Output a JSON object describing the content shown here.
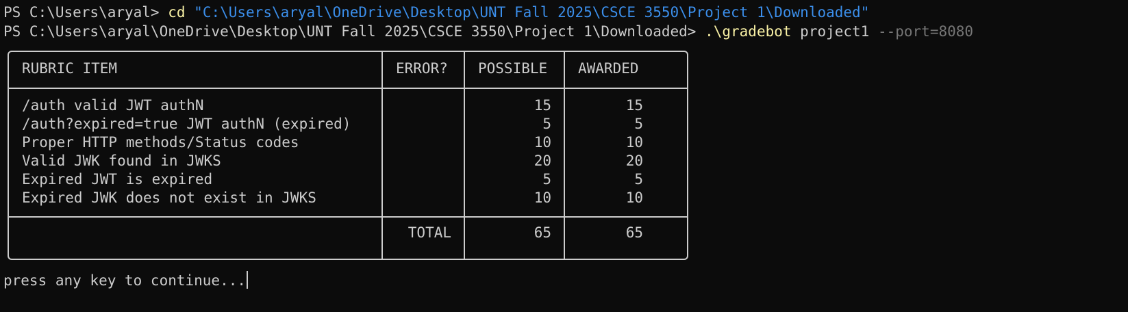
{
  "terminal": {
    "line1": {
      "prompt": "PS C:\\Users\\aryal> ",
      "command": "cd",
      "argument": "\"C:\\Users\\aryal\\OneDrive\\Desktop\\UNT Fall 2025\\CSCE 3550\\Project 1\\Downloaded\""
    },
    "line2": {
      "prompt": "PS C:\\Users\\aryal\\OneDrive\\Desktop\\UNT Fall 2025\\CSCE 3550\\Project 1\\Downloaded> ",
      "command": ".\\gradebot",
      "argument": " project1 ",
      "flag": "--port=8080"
    },
    "press_key": "press any key to continue..."
  },
  "rubric": {
    "headers": {
      "item": "RUBRIC ITEM",
      "error": "ERROR?",
      "possible": "POSSIBLE",
      "awarded": "AWARDED"
    },
    "rows": [
      {
        "item": "/auth valid JWT authN",
        "error": "",
        "possible": "15",
        "awarded": "15"
      },
      {
        "item": "/auth?expired=true JWT authN (expired)",
        "error": "",
        "possible": "5",
        "awarded": "5"
      },
      {
        "item": "Proper HTTP methods/Status codes",
        "error": "",
        "possible": "10",
        "awarded": "10"
      },
      {
        "item": "Valid JWK found in JWKS",
        "error": "",
        "possible": "20",
        "awarded": "20"
      },
      {
        "item": "Expired JWT is expired",
        "error": "",
        "possible": "5",
        "awarded": "5"
      },
      {
        "item": "Expired JWK does not exist in JWKS",
        "error": "",
        "possible": "10",
        "awarded": "10"
      }
    ],
    "total": {
      "label": "TOTAL",
      "possible": "65",
      "awarded": "65"
    }
  },
  "colors": {
    "background": "#0c0c0c",
    "foreground": "#cccccc",
    "command": "#f9f1a5",
    "string": "#3b8eea",
    "flag": "#767676"
  }
}
